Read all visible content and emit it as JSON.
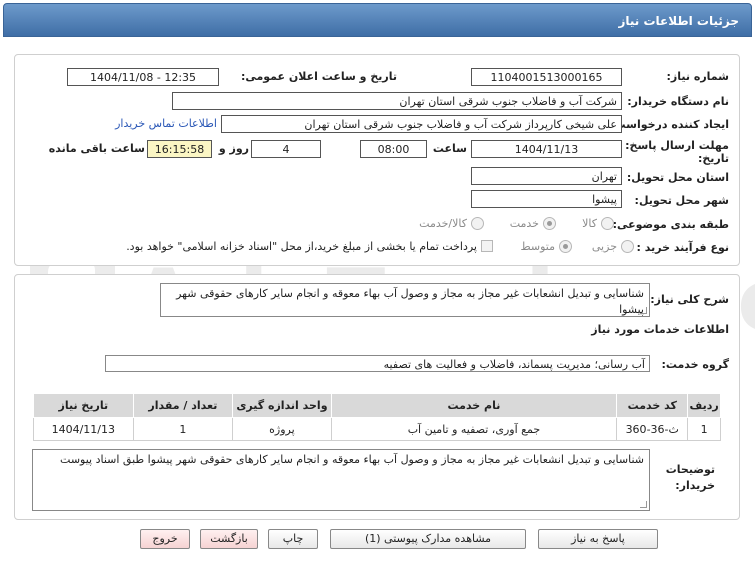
{
  "header": {
    "title": "جزئیات اطلاعات نیاز"
  },
  "form": {
    "need_number_label": "شماره نیاز:",
    "need_number": "1104001513000165",
    "announce_label": "تاریخ و ساعت اعلان عمومی:",
    "announce_value": "1404/11/08 - 12:35",
    "buyer_org_label": "نام دستگاه خریدار:",
    "buyer_org": "شرکت آب و فاضلاب جنوب شرقی استان تهران",
    "requester_label": "ایجاد کننده درخواست:",
    "requester": "علی شیخی کارپرداز شرکت آب و فاضلاب جنوب شرقی استان تهران",
    "contact_link": "اطلاعات تماس خریدار",
    "deadline_label_line1": "مهلت ارسال پاسخ: تا",
    "deadline_label_line2": "تاریخ:",
    "deadline_date": "1404/11/13",
    "time_label": "ساعت",
    "deadline_time": "08:00",
    "days_value": "4",
    "days_label": "روز و",
    "remaining_time": "16:15:58",
    "remaining_label": "ساعت باقی مانده",
    "province_label": "استان محل تحویل:",
    "province": "تهران",
    "city_label": "شهر محل تحویل:",
    "city": "پیشوا",
    "category_label": "طبقه بندی موضوعی:",
    "category_options": [
      "کالا",
      "خدمت",
      "کالا/خدمت"
    ],
    "purchase_type_label": "نوع فرآیند خرید :",
    "purchase_options": [
      "جزیی",
      "متوسط"
    ],
    "payment_note": "پرداخت تمام یا بخشی از مبلغ خرید،از محل \"اسناد خزانه اسلامی\" خواهد بود."
  },
  "details": {
    "description_label": "شرح کلی نیاز:",
    "description": "شناسایی و تبدیل انشعابات غیر مجاز به مجاز و وصول آب بهاء معوقه و انجام سایر کارهای حقوقی شهر پیشوا",
    "services_heading": "اطلاعات خدمات مورد نیاز",
    "service_group_label": "گروه خدمت:",
    "service_group": "آب رسانی؛ مدیریت پسماند، فاضلاب و فعالیت های تصفیه",
    "table": {
      "headers": [
        "ردیف",
        "کد خدمت",
        "نام خدمت",
        "واحد اندازه گیری",
        "تعداد / مقدار",
        "تاریخ نیاز"
      ],
      "rows": [
        [
          "1",
          "ث-36-360",
          "جمع آوری، تصفیه و تامین آب",
          "پروژه",
          "1",
          "1404/11/13"
        ]
      ]
    },
    "buyer_notes_label_line1": "توضیحات",
    "buyer_notes_label_line2": "خریدار:",
    "buyer_notes": "شناسایی و تبدیل انشعابات غیر مجاز به مجاز و وصول آب بهاء معوقه و انجام سایر کارهای حقوقی شهر پیشوا طبق اسناد پیوست"
  },
  "buttons": {
    "reply": "پاسخ به نیاز",
    "view_docs": "مشاهده مدارک پیوستی (1)",
    "print": "چاپ",
    "back": "بازگشت",
    "exit": "خروج"
  },
  "watermark": {
    "text": "AriaTender.net"
  },
  "colors": {
    "header_bg": "#4a78ad",
    "link": "#2a57b6",
    "table_header_bg": "#d9d9d9",
    "watermark": "#e9e9e9"
  }
}
